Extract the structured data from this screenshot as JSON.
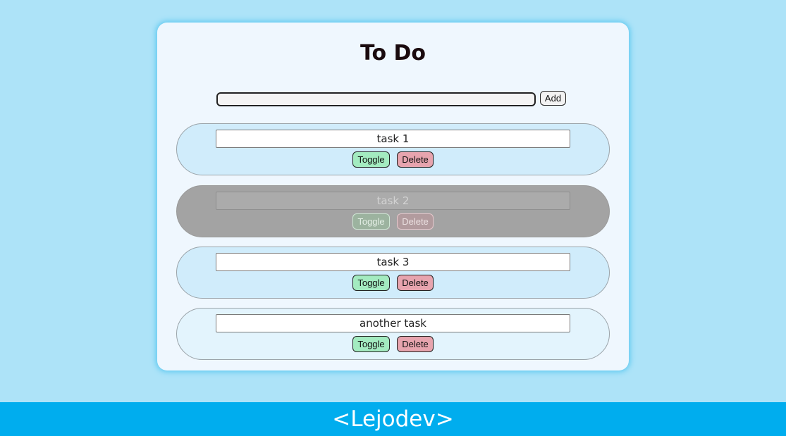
{
  "app": {
    "title": "To Do"
  },
  "new_task": {
    "value": "",
    "placeholder": "",
    "add_label": "Add"
  },
  "tasks": [
    {
      "text": "task 1",
      "completed": false,
      "toggle_label": "Toggle",
      "delete_label": "Delete"
    },
    {
      "text": "task 2",
      "completed": true,
      "toggle_label": "Toggle",
      "delete_label": "Delete"
    },
    {
      "text": "task 3",
      "completed": false,
      "toggle_label": "Toggle",
      "delete_label": "Delete"
    },
    {
      "text": "another task",
      "completed": false,
      "toggle_label": "Toggle",
      "delete_label": "Delete"
    }
  ],
  "footer": {
    "brand": "<Lejodev>"
  },
  "colors": {
    "page_background": "#ade3f8",
    "card_background": "#eff7fe",
    "task_background": "#d0ecfb",
    "completed_task_background": "#a3a3a3",
    "toggle_button": "#a3ebc0",
    "delete_button": "#e7a4ae",
    "footer_background": "#00adee"
  }
}
